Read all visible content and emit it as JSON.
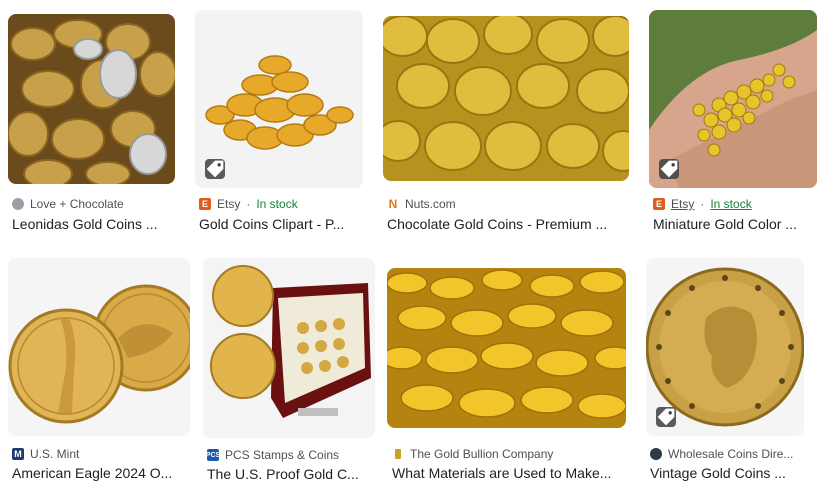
{
  "results": [
    {
      "source": "Love + Chocolate",
      "stock": "",
      "title": "Leonidas Gold Coins ...",
      "favicon": "globe-icon"
    },
    {
      "source": "Etsy",
      "stock": "In stock",
      "title": "Gold Coins Clipart - P...",
      "favicon": "etsy-icon"
    },
    {
      "source": "Nuts.com",
      "stock": "",
      "title": "Chocolate Gold Coins - Premium ...",
      "favicon": "nuts-icon"
    },
    {
      "source": "Etsy",
      "stock": "In stock",
      "title": "Miniature Gold Color ...",
      "favicon": "etsy-icon"
    },
    {
      "source": "U.S. Mint",
      "stock": "",
      "title": "American Eagle 2024 O...",
      "favicon": "usmint-icon"
    },
    {
      "source": "PCS Stamps & Coins",
      "stock": "",
      "title": "The U.S. Proof Gold C...",
      "favicon": "pcs-icon"
    },
    {
      "source": "The Gold Bullion Company",
      "stock": "",
      "title": "What Materials are Used to Make...",
      "favicon": "bullion-icon"
    },
    {
      "source": "Wholesale Coins Dire...",
      "stock": "",
      "title": "Vintage Gold Coins ...",
      "favicon": "wholesale-icon"
    }
  ],
  "colors": {
    "gold": "#d4a52a",
    "stock_green": "#188038",
    "etsy_orange": "#e05c1a"
  }
}
